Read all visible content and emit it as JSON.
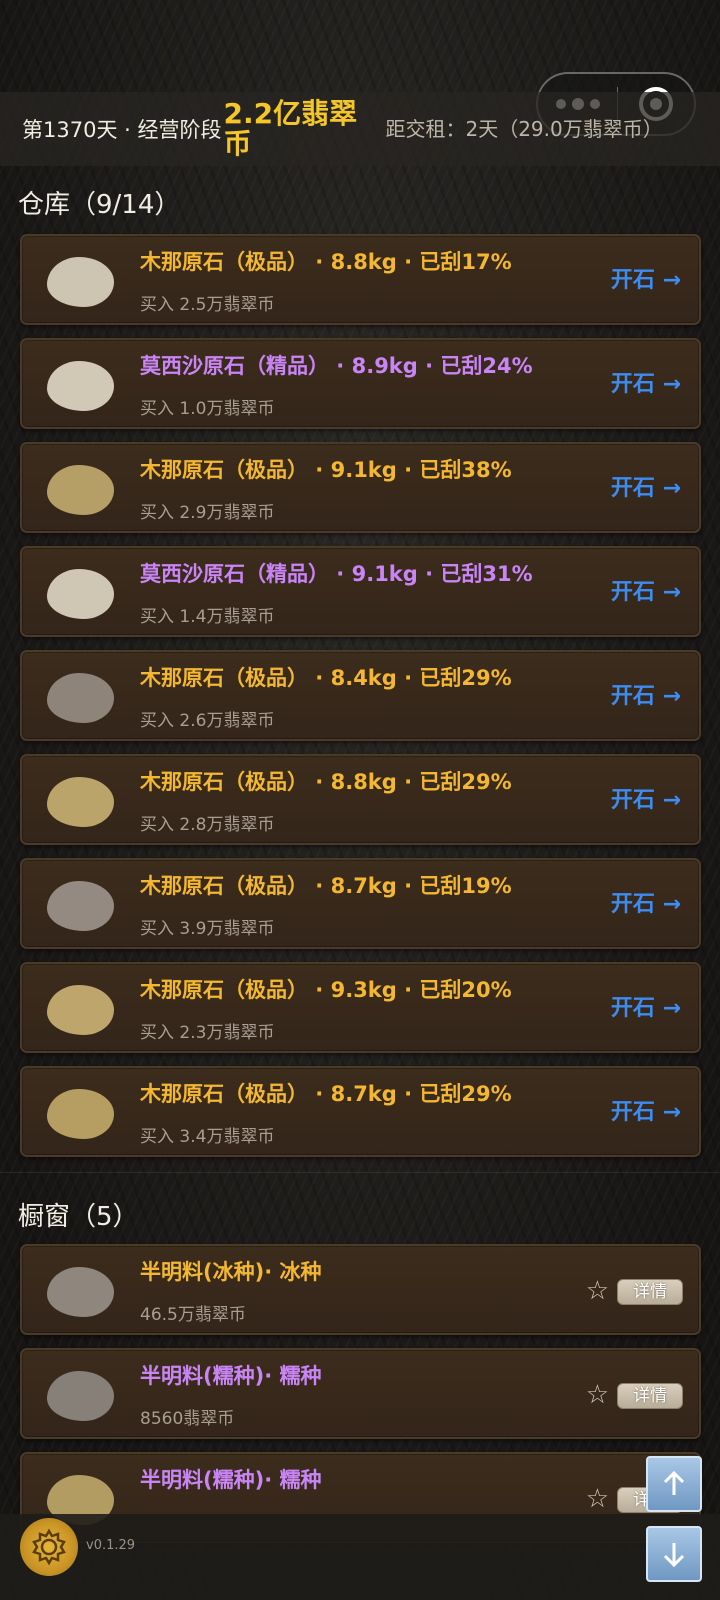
{
  "topbar": {
    "day": "第1370天 · 经营阶段",
    "money": "2.2亿翡翠币",
    "rent": "距交租：2天（29.0万翡翠币）"
  },
  "warehouse": {
    "title": "仓库（9/14）",
    "open_label": "开石 →",
    "items": [
      {
        "title": "木那原石（极品） · 8.8kg · 已刮17%",
        "price": "买入 2.5万翡翠币",
        "tier": "gold",
        "stone_color": "#cdc4b2"
      },
      {
        "title": "莫西沙原石（精品） · 8.9kg · 已刮24%",
        "price": "买入 1.0万翡翠币",
        "tier": "purple",
        "stone_color": "#d2c8b6"
      },
      {
        "title": "木那原石（极品） · 9.1kg · 已刮38%",
        "price": "买入 2.9万翡翠币",
        "tier": "gold",
        "stone_color": "#b59f67"
      },
      {
        "title": "莫西沙原石（精品） · 9.1kg · 已刮31%",
        "price": "买入 1.4万翡翠币",
        "tier": "purple",
        "stone_color": "#cfc6b4"
      },
      {
        "title": "木那原石（极品） · 8.4kg · 已刮29%",
        "price": "买入 2.6万翡翠币",
        "tier": "gold",
        "stone_color": "#8e847a"
      },
      {
        "title": "木那原石（极品） · 8.8kg · 已刮29%",
        "price": "买入 2.8万翡翠币",
        "tier": "gold",
        "stone_color": "#bba46a"
      },
      {
        "title": "木那原石（极品） · 8.7kg · 已刮19%",
        "price": "买入 3.9万翡翠币",
        "tier": "gold",
        "stone_color": "#948a82"
      },
      {
        "title": "木那原石（极品） · 9.3kg · 已刮20%",
        "price": "买入 2.3万翡翠币",
        "tier": "gold",
        "stone_color": "#bda56c"
      },
      {
        "title": "木那原石（极品） · 8.7kg · 已刮29%",
        "price": "买入 3.4万翡翠币",
        "tier": "gold",
        "stone_color": "#b69e62"
      }
    ]
  },
  "showcase": {
    "title": "橱窗（5）",
    "detail_label": "详情",
    "star_icon": "☆",
    "items": [
      {
        "title": "半明料(冰种)· 冰种",
        "price": "46.5万翡翠币",
        "tier": "gold",
        "stone_color": "#8f867e"
      },
      {
        "title": "半明料(糯种)· 糯种",
        "price": "8560翡翠币",
        "tier": "purple",
        "stone_color": "#878079"
      },
      {
        "title": "半明料(糯种)· 糯种",
        "price": "",
        "tier": "purple",
        "stone_color": "#b29c62"
      }
    ]
  },
  "footer": {
    "version": "v0.1.29",
    "gear_icon": "gear-icon",
    "up_icon": "arrow-up-icon",
    "down_icon": "arrow-down-icon"
  }
}
